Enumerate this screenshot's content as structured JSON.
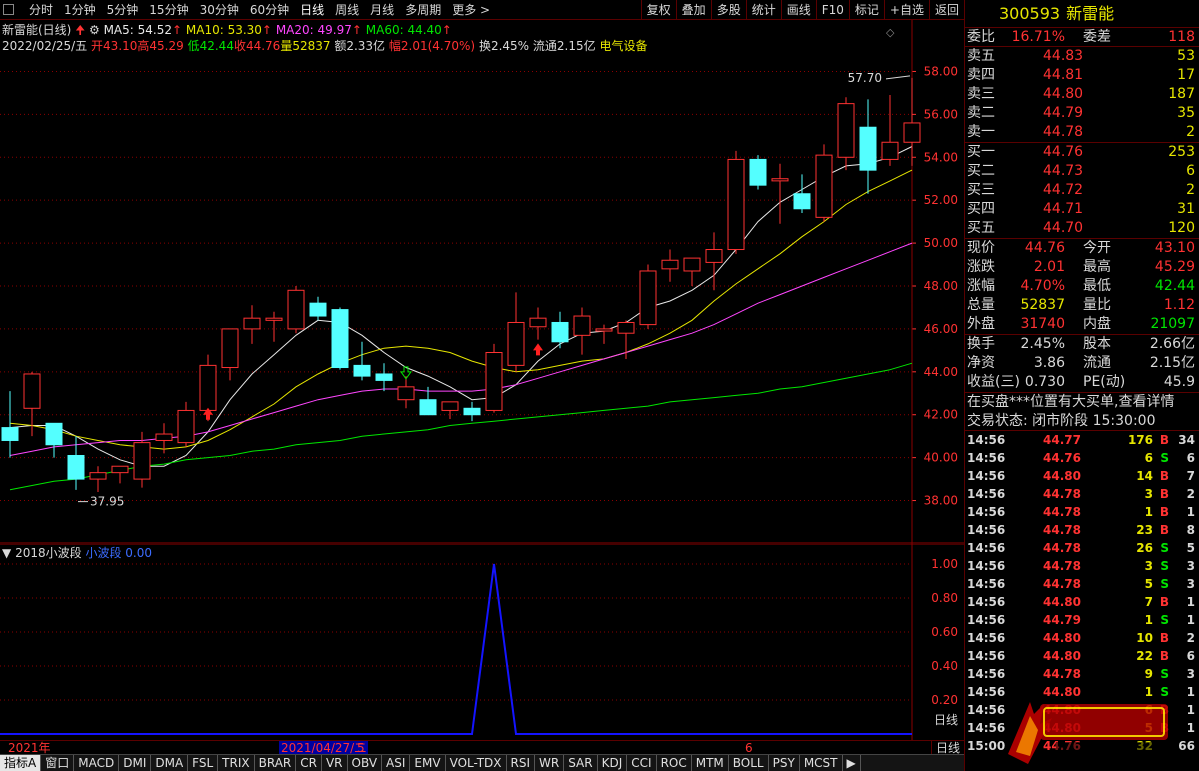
{
  "toolbar": {
    "periods": [
      "分时",
      "1分钟",
      "5分钟",
      "15分钟",
      "30分钟",
      "60分钟",
      "日线",
      "周线",
      "月线",
      "多周期",
      "更多 >"
    ],
    "active_period": "日线",
    "tools": [
      "复权",
      "叠加",
      "多股",
      "统计",
      "画线",
      "F10",
      "标记",
      "+自选",
      "返回"
    ]
  },
  "stock": {
    "name_label": "新雷能(日线)",
    "ma5": "MA5: 54.52",
    "ma10": "MA10: 53.30",
    "ma20": "MA20: 49.97",
    "ma60": "MA60: 44.40",
    "date": "2022/02/25/五",
    "open": "开43.10",
    "high": "高45.29",
    "low": "低42.44",
    "close": "收44.76",
    "volume": "量52837",
    "amount": "额2.33亿",
    "change": "幅2.01(4.70%)",
    "turnover": "换2.45%",
    "float": "流通2.15亿",
    "sector": "电气设备"
  },
  "chart_data": {
    "type": "candlestick",
    "ylim": [
      37.0,
      59.0
    ],
    "y_ticks": [
      "58.00",
      "56.00",
      "54.00",
      "52.00",
      "50.00",
      "48.00",
      "46.00",
      "44.00",
      "42.00",
      "40.00",
      "38.00"
    ],
    "max_label": "57.70",
    "min_label": "37.95",
    "candles": [
      [
        41.4,
        43.1,
        40.0,
        40.8
      ],
      [
        42.3,
        44.0,
        41.0,
        43.9
      ],
      [
        41.6,
        41.6,
        40.0,
        40.6
      ],
      [
        40.1,
        41.0,
        38.5,
        39.0
      ],
      [
        39.0,
        39.6,
        38.4,
        39.3
      ],
      [
        39.3,
        39.6,
        38.8,
        39.6
      ],
      [
        39.0,
        41.2,
        38.6,
        40.7
      ],
      [
        40.8,
        41.6,
        40.2,
        41.1
      ],
      [
        40.7,
        42.6,
        40.5,
        42.2
      ],
      [
        42.2,
        44.8,
        41.7,
        44.3
      ],
      [
        44.2,
        46.0,
        43.6,
        46.0
      ],
      [
        46.0,
        47.1,
        45.3,
        46.5
      ],
      [
        46.4,
        46.8,
        45.4,
        46.5
      ],
      [
        46.0,
        48.0,
        45.8,
        47.8
      ],
      [
        47.2,
        47.5,
        46.4,
        46.6
      ],
      [
        46.9,
        47.0,
        44.1,
        44.2
      ],
      [
        44.3,
        45.4,
        43.6,
        43.8
      ],
      [
        43.9,
        44.4,
        43.1,
        43.6
      ],
      [
        42.7,
        43.8,
        42.3,
        43.3
      ],
      [
        42.7,
        43.3,
        42.0,
        42.0
      ],
      [
        42.2,
        42.6,
        41.8,
        42.6
      ],
      [
        42.3,
        42.6,
        41.7,
        42.0
      ],
      [
        42.2,
        45.3,
        42.1,
        44.9
      ],
      [
        44.3,
        47.7,
        44.0,
        46.3
      ],
      [
        46.1,
        47.0,
        45.5,
        46.5
      ],
      [
        46.3,
        46.8,
        45.1,
        45.4
      ],
      [
        45.7,
        47.0,
        44.8,
        46.6
      ],
      [
        45.9,
        46.2,
        45.3,
        46.0
      ],
      [
        45.8,
        46.4,
        44.6,
        46.3
      ],
      [
        46.2,
        49.0,
        46.0,
        48.7
      ],
      [
        48.8,
        49.7,
        48.2,
        49.2
      ],
      [
        48.7,
        49.3,
        48.0,
        49.3
      ],
      [
        49.1,
        50.5,
        47.8,
        49.7
      ],
      [
        49.7,
        54.3,
        49.5,
        53.9
      ],
      [
        53.9,
        54.1,
        52.5,
        52.7
      ],
      [
        52.9,
        53.7,
        50.9,
        53.0
      ],
      [
        52.3,
        53.2,
        51.4,
        51.6
      ],
      [
        51.2,
        54.6,
        51.0,
        54.1
      ],
      [
        54.0,
        56.8,
        53.4,
        56.5
      ],
      [
        55.4,
        56.7,
        52.3,
        53.4
      ],
      [
        53.9,
        56.9,
        53.6,
        54.7
      ],
      [
        54.7,
        57.7,
        53.6,
        55.6
      ]
    ],
    "markers": [
      {
        "type": "up-arrow",
        "index": 9,
        "value": 42.0
      },
      {
        "type": "up-arrow",
        "index": 24,
        "value": 45.0
      },
      {
        "type": "down-arrow",
        "index": 18,
        "value": 44.0
      }
    ],
    "ma_lines": {
      "MA5": [
        41.4,
        41.5,
        41.5,
        41.0,
        40.4,
        39.9,
        39.6,
        39.6,
        40.1,
        41.2,
        42.7,
        43.9,
        44.8,
        45.7,
        46.4,
        46.3,
        45.7,
        44.9,
        44.2,
        43.8,
        43.3,
        42.7,
        42.8,
        43.4,
        44.5,
        45.3,
        45.8,
        45.9,
        46.3,
        47.0,
        47.3,
        47.8,
        48.5,
        49.7,
        51.0,
        51.9,
        52.5,
        53.1,
        53.6,
        53.7,
        54.0,
        54.5
      ],
      "MA10": [
        41.6,
        41.5,
        41.3,
        41.0,
        40.8,
        40.6,
        40.5,
        40.4,
        40.5,
        40.8,
        41.3,
        41.9,
        42.5,
        43.3,
        43.9,
        44.4,
        44.8,
        45.1,
        45.2,
        45.1,
        44.9,
        44.5,
        44.2,
        44.0,
        44.1,
        44.3,
        44.5,
        44.6,
        44.9,
        45.3,
        45.8,
        46.4,
        47.3,
        48.1,
        48.8,
        49.5,
        50.3,
        51.0,
        51.8,
        52.4,
        52.9,
        53.4
      ],
      "MA20": [
        40.1,
        40.3,
        40.5,
        40.6,
        40.7,
        40.8,
        40.8,
        40.9,
        41.0,
        41.2,
        41.5,
        41.8,
        42.1,
        42.4,
        42.7,
        42.9,
        43.1,
        43.2,
        43.2,
        43.1,
        43.1,
        43.1,
        43.2,
        43.4,
        43.7,
        44.0,
        44.3,
        44.6,
        44.9,
        45.2,
        45.5,
        45.8,
        46.2,
        46.7,
        47.2,
        47.6,
        48.0,
        48.4,
        48.8,
        49.2,
        49.6,
        50.0
      ],
      "MA60": [
        38.5,
        38.7,
        38.9,
        39.0,
        39.2,
        39.4,
        39.6,
        39.7,
        39.9,
        40.0,
        40.1,
        40.3,
        40.4,
        40.6,
        40.7,
        40.8,
        41.0,
        41.1,
        41.2,
        41.3,
        41.5,
        41.6,
        41.7,
        41.8,
        41.9,
        42.0,
        42.1,
        42.2,
        42.3,
        42.4,
        42.6,
        42.7,
        42.8,
        42.9,
        43.0,
        43.2,
        43.3,
        43.5,
        43.7,
        43.9,
        44.1,
        44.4
      ]
    },
    "colors": {
      "up": "#ff3232",
      "down": "#54ffff",
      "ma5": "#e8e8e8",
      "ma10": "#e6e600",
      "ma20": "#ff46ff",
      "ma60": "#00e600",
      "indicator": "#1414ff",
      "grid": "#8b0000"
    }
  },
  "indicator": {
    "name": "2018小波段",
    "line_label": "小波段",
    "value": "0.00",
    "y_ticks": [
      "1.00",
      "0.80",
      "0.60",
      "0.40",
      "0.20"
    ],
    "unit": "日线",
    "spike_index": 22,
    "spike_value": 1.0
  },
  "dates": {
    "left": "2021年",
    "highlight": "2021/04/27/二",
    "mark_5": "5",
    "mark_6": "6",
    "unit": "日线"
  },
  "tabs": [
    "指标A",
    "窗口",
    "MACD",
    "DMI",
    "DMA",
    "FSL",
    "TRIX",
    "BRAR",
    "CR",
    "VR",
    "OBV",
    "ASI",
    "EMV",
    "VOL-TDX",
    "RSI",
    "WR",
    "SAR",
    "KDJ",
    "CCI",
    "ROC",
    "MTM",
    "BOLL",
    "PSY",
    "MCST",
    "▶"
  ],
  "tabs_right": [
    "指标B",
    "模板",
    "◀"
  ],
  "panel": {
    "code": "300593",
    "name": "新雷能",
    "weibi": {
      "label": "委比",
      "value": "16.71%",
      "label2": "委差",
      "value2": "118"
    },
    "asks": [
      {
        "label": "卖五",
        "price": "44.83",
        "vol": "53"
      },
      {
        "label": "卖四",
        "price": "44.81",
        "vol": "17"
      },
      {
        "label": "卖三",
        "price": "44.80",
        "vol": "187"
      },
      {
        "label": "卖二",
        "price": "44.79",
        "vol": "35"
      },
      {
        "label": "卖一",
        "price": "44.78",
        "vol": "2"
      }
    ],
    "bids": [
      {
        "label": "买一",
        "price": "44.76",
        "vol": "253"
      },
      {
        "label": "买二",
        "price": "44.73",
        "vol": "6"
      },
      {
        "label": "买三",
        "price": "44.72",
        "vol": "2"
      },
      {
        "label": "买四",
        "price": "44.71",
        "vol": "31"
      },
      {
        "label": "买五",
        "price": "44.70",
        "vol": "120"
      }
    ],
    "stats": [
      {
        "l1": "现价",
        "v1": "44.76",
        "c1": "r",
        "l2": "今开",
        "v2": "43.10",
        "c2": "r"
      },
      {
        "l1": "涨跌",
        "v1": "2.01",
        "c1": "r",
        "l2": "最高",
        "v2": "45.29",
        "c2": "r"
      },
      {
        "l1": "涨幅",
        "v1": "4.70%",
        "c1": "r",
        "l2": "最低",
        "v2": "42.44",
        "c2": "g"
      },
      {
        "l1": "总量",
        "v1": "52837",
        "c1": "y",
        "l2": "量比",
        "v2": "1.12",
        "c2": "r"
      },
      {
        "l1": "外盘",
        "v1": "31740",
        "c1": "r",
        "l2": "内盘",
        "v2": "21097",
        "c2": "g"
      }
    ],
    "stats2": [
      {
        "l1": "换手",
        "v1": "2.45%",
        "c1": "w",
        "l2": "股本",
        "v2": "2.66亿",
        "c2": "w"
      },
      {
        "l1": "净资",
        "v1": "3.86",
        "c1": "w",
        "l2": "流通",
        "v2": "2.15亿",
        "c2": "w"
      },
      {
        "l1": "收益(三)",
        "v1": "0.730",
        "c1": "w",
        "l2": "PE(动)",
        "v2": "45.9",
        "c2": "w"
      }
    ],
    "notice": "在买盘***位置有大买单,查看详情",
    "status": "交易状态: 闭市阶段 15:30:00",
    "ticks": [
      {
        "t": "14:56",
        "p": "44.77",
        "q": "176",
        "d": "B",
        "n": "34"
      },
      {
        "t": "14:56",
        "p": "44.76",
        "q": "6",
        "d": "S",
        "n": "6"
      },
      {
        "t": "14:56",
        "p": "44.80",
        "q": "14",
        "d": "B",
        "n": "7"
      },
      {
        "t": "14:56",
        "p": "44.78",
        "q": "3",
        "d": "B",
        "n": "2"
      },
      {
        "t": "14:56",
        "p": "44.78",
        "q": "1",
        "d": "B",
        "n": "1"
      },
      {
        "t": "14:56",
        "p": "44.78",
        "q": "23",
        "d": "B",
        "n": "8"
      },
      {
        "t": "14:56",
        "p": "44.78",
        "q": "26",
        "d": "S",
        "n": "5"
      },
      {
        "t": "14:56",
        "p": "44.78",
        "q": "3",
        "d": "S",
        "n": "3"
      },
      {
        "t": "14:56",
        "p": "44.78",
        "q": "5",
        "d": "S",
        "n": "3"
      },
      {
        "t": "14:56",
        "p": "44.80",
        "q": "7",
        "d": "B",
        "n": "1"
      },
      {
        "t": "14:56",
        "p": "44.79",
        "q": "1",
        "d": "S",
        "n": "1"
      },
      {
        "t": "14:56",
        "p": "44.80",
        "q": "10",
        "d": "B",
        "n": "2"
      },
      {
        "t": "14:56",
        "p": "44.80",
        "q": "22",
        "d": "B",
        "n": "6"
      },
      {
        "t": "14:56",
        "p": "44.78",
        "q": "9",
        "d": "S",
        "n": "3"
      },
      {
        "t": "14:56",
        "p": "44.80",
        "q": "1",
        "d": "S",
        "n": "1"
      },
      {
        "t": "14:56",
        "p": "44.80",
        "q": "6",
        "d": "B",
        "n": "1"
      },
      {
        "t": "14:56",
        "p": "44.80",
        "q": "5",
        "d": "B",
        "n": "1"
      },
      {
        "t": "15:00",
        "p": "44.76",
        "q": "32",
        "d": "",
        "n": "66"
      }
    ]
  }
}
